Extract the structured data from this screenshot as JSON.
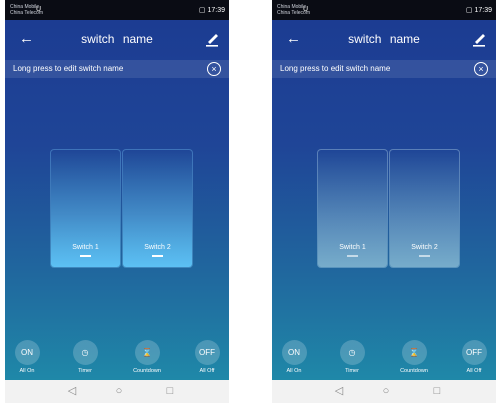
{
  "status": {
    "carrier_line1": "China Mobile",
    "carrier_line2": "China Telecom",
    "carrier_icon": "U",
    "signal_text": "≀ ᴺ∴∴ ᴺ∴∴",
    "signal_text_plain": "≋ ⁴ᴳ.ıl ⁴ᴳ.ıl",
    "battery_time": "▢ 17:39"
  },
  "header": {
    "back_glyph": "←",
    "title": "switch name"
  },
  "hint": {
    "text": "Long press to edit switch name",
    "close_glyph": "×"
  },
  "switches": [
    {
      "label": "Switch 1"
    },
    {
      "label": "Switch 2"
    }
  ],
  "controls": [
    {
      "icon_text": "ON",
      "label": "All On"
    },
    {
      "icon_text": "◷",
      "label": "Timer"
    },
    {
      "icon_text": "⌛",
      "label": "Countdown"
    },
    {
      "icon_text": "OFF",
      "label": "All Off"
    }
  ],
  "navbar": {
    "back": "◁",
    "home": "○",
    "recent": "□"
  },
  "colors": {
    "bg_top": "#1c3c92",
    "bg_bottom": "#1f88a8",
    "switch_active": "#5cc0f4"
  }
}
